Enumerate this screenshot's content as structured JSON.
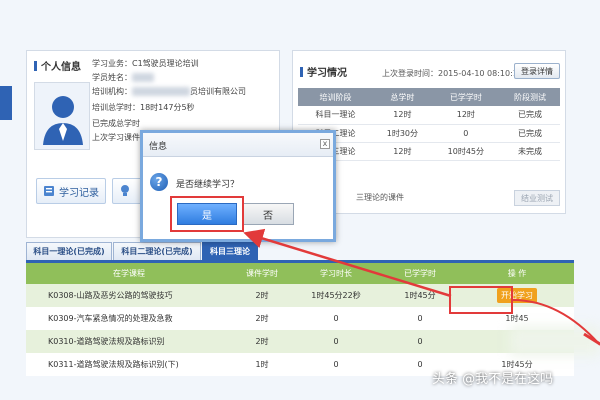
{
  "info_panel": {
    "title": "个人信息",
    "lines": [
      "学习业务：C1驾驶员理论培训",
      "学员姓名：",
      "培训机构：",
      "培训总学时：18时147分5秒",
      "已完成总学时",
      "上次学习课件"
    ],
    "org_suffix": "员培训有限公司",
    "study_record_label": "学习记录"
  },
  "study_panel": {
    "title": "学习情况",
    "last_login_label": "上次登录时间：",
    "last_login_value": "2015-04-10 08:10:11",
    "login_detail_label": "登录详情",
    "columns": [
      "培训阶段",
      "总学时",
      "已学学时",
      "阶段测试"
    ],
    "rows": [
      [
        "科目一理论",
        "12时",
        "12时",
        "已完成"
      ],
      [
        "科目二理论",
        "1时30分",
        "0",
        "已完成"
      ],
      [
        "科目三理论",
        "12时",
        "10时45分",
        "未完成"
      ]
    ],
    "extra_note": "三理论的课件",
    "finish_exam_label": "结业测试"
  },
  "tabs": [
    "科目一理论(已完成)",
    "科目二理论(已完成)",
    "科目三理论"
  ],
  "course_table": {
    "columns": [
      "在学课程",
      "课件学时",
      "学习时长",
      "已学学时",
      "操 作"
    ],
    "rows": [
      {
        "name": "K0308-山路及恶劣公路的驾驶技巧",
        "hours": "2时",
        "duration": "1时45分22秒",
        "learned": "1时45分",
        "action": "开始学习"
      },
      {
        "name": "K0309-汽车紧急情况的处理及急救",
        "hours": "2时",
        "duration": "0",
        "learned": "0",
        "action": "1时45"
      },
      {
        "name": "K0310-道路驾驶法规及路标识别",
        "hours": "2时",
        "duration": "0",
        "learned": "0",
        "action": ""
      },
      {
        "name": "K0311-道路驾驶法规及路标识别(下)",
        "hours": "1时",
        "duration": "0",
        "learned": "0",
        "action": "1时45分"
      }
    ]
  },
  "dialog": {
    "title": "信息",
    "close": "x",
    "message": "是否继续学习？",
    "yes_label": "是",
    "no_label": "否",
    "icon": "question-icon"
  },
  "watermark": "头条 @我不是在这吗",
  "colors": {
    "accent": "#2f63b4",
    "table_header": "#90bf5a",
    "start_button": "#f0a11e",
    "annotation": "#e23a3a"
  }
}
